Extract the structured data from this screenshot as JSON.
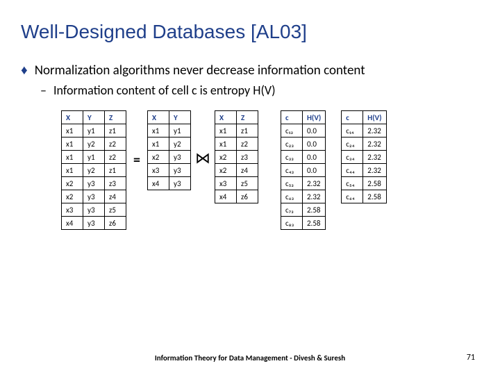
{
  "title": "Well-Designed Databases [AL03]",
  "bullet1": "Normalization algorithms never decrease information content",
  "bullet2": "Information content of cell c is entropy H(V)",
  "eq": "=",
  "join": "⋈",
  "tableR": {
    "head": [
      "X",
      "Y",
      "Z"
    ],
    "rows": [
      [
        "x1",
        "y1",
        "z1"
      ],
      [
        "x1",
        "y2",
        "z2"
      ],
      [
        "x1",
        "y1",
        "z2"
      ],
      [
        "x1",
        "y2",
        "z1"
      ],
      [
        "x2",
        "y3",
        "z3"
      ],
      [
        "x2",
        "y3",
        "z4"
      ],
      [
        "x3",
        "y3",
        "z5"
      ],
      [
        "x4",
        "y3",
        "z6"
      ]
    ]
  },
  "tableXY": {
    "head": [
      "X",
      "Y"
    ],
    "rows": [
      [
        "x1",
        "y1"
      ],
      [
        "x1",
        "y2"
      ],
      [
        "x2",
        "y3"
      ],
      [
        "x3",
        "y3"
      ],
      [
        "x4",
        "y3"
      ]
    ]
  },
  "tableXZ": {
    "head": [
      "X",
      "Z"
    ],
    "rows": [
      [
        "x1",
        "z1"
      ],
      [
        "x1",
        "z2"
      ],
      [
        "x2",
        "z3"
      ],
      [
        "x2",
        "z4"
      ],
      [
        "x3",
        "z5"
      ],
      [
        "x4",
        "z6"
      ]
    ]
  },
  "tableHV1": {
    "head": [
      "c",
      "H(V)"
    ],
    "rows": [
      [
        "c₁₃",
        "0.0"
      ],
      [
        "c₂₃",
        "0.0"
      ],
      [
        "c₃₃",
        "0.0"
      ],
      [
        "c₄₃",
        "0.0"
      ],
      [
        "c₅₃",
        "2.32"
      ],
      [
        "c₆₃",
        "2.32"
      ],
      [
        "c₇₃",
        "2.58"
      ],
      [
        "c₈₃",
        "2.58"
      ]
    ]
  },
  "tableHV2": {
    "head": [
      "c",
      "H(V)"
    ],
    "rows": [
      [
        "c₁₄",
        "2.32"
      ],
      [
        "c₂₄",
        "2.32"
      ],
      [
        "c₃₄",
        "2.32"
      ],
      [
        "c₄₄",
        "2.32"
      ],
      [
        "c₅₄",
        "2.58"
      ],
      [
        "c₆₄",
        "2.58"
      ]
    ]
  },
  "footer": "Information Theory for Data Management - Divesh & Suresh",
  "pagenum": "71"
}
